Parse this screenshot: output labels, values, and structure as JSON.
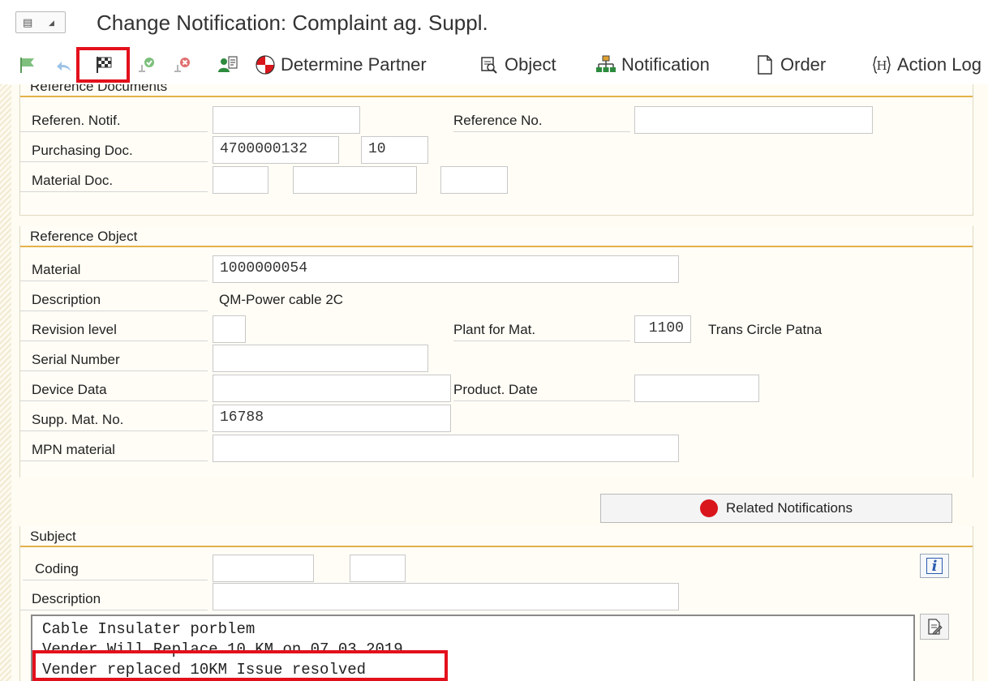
{
  "window": {
    "title": "Change Notification: Complaint ag. Suppl."
  },
  "toolbar": {
    "icons": [
      "flag-icon",
      "undo-icon",
      "checkered-flag-icon",
      "put-in-process-icon",
      "postpone-icon",
      "person-transfer-icon"
    ],
    "buttons": [
      {
        "label": "Determine Partner",
        "icon": "determine-partner-icon"
      },
      {
        "label": "Object",
        "icon": "object-icon"
      },
      {
        "label": "Notification",
        "icon": "notification-icon"
      },
      {
        "label": "Order",
        "icon": "order-icon"
      },
      {
        "label": "Action Log",
        "icon": "action-log-icon"
      }
    ]
  },
  "reference_documents": {
    "title": "Reference Documents",
    "referen_notif": {
      "label": "Referen. Notif.",
      "value": ""
    },
    "reference_no": {
      "label": "Reference No.",
      "value": ""
    },
    "purchasing_doc": {
      "label": "Purchasing Doc.",
      "value": "4700000132",
      "item": "10"
    },
    "material_doc": {
      "label": "Material Doc.",
      "value": "",
      "year": "",
      "item": ""
    }
  },
  "reference_object": {
    "title": "Reference Object",
    "material": {
      "label": "Material",
      "value": "1000000054"
    },
    "description": {
      "label": "Description",
      "value": "QM-Power cable 2C"
    },
    "revision_level": {
      "label": "Revision level",
      "value": ""
    },
    "plant": {
      "label": "Plant for Mat.",
      "value": "1100",
      "name": "Trans Circle Patna"
    },
    "serial_number": {
      "label": "Serial Number",
      "value": ""
    },
    "device_data": {
      "label": "Device Data",
      "value": ""
    },
    "product_date": {
      "label": "Product. Date",
      "value": ""
    },
    "supp_mat_no": {
      "label": "Supp. Mat. No.",
      "value": "16788"
    },
    "mpn_material": {
      "label": "MPN material",
      "value": ""
    }
  },
  "related_notifications": {
    "label": "Related Notifications"
  },
  "subject": {
    "title": "Subject",
    "coding": {
      "label": "Coding",
      "group": "",
      "code": ""
    },
    "description": {
      "label": "Description",
      "value": ""
    },
    "long_text": [
      "Cable Insulater porblem",
      "Vender Will Replace 10 KM on 07.03.2019",
      "Vender replaced 10KM Issue resolved"
    ]
  },
  "colors": {
    "highlight": "#e3101c",
    "group_border": "#e2b24a",
    "work_bg": "#fefcf3"
  }
}
